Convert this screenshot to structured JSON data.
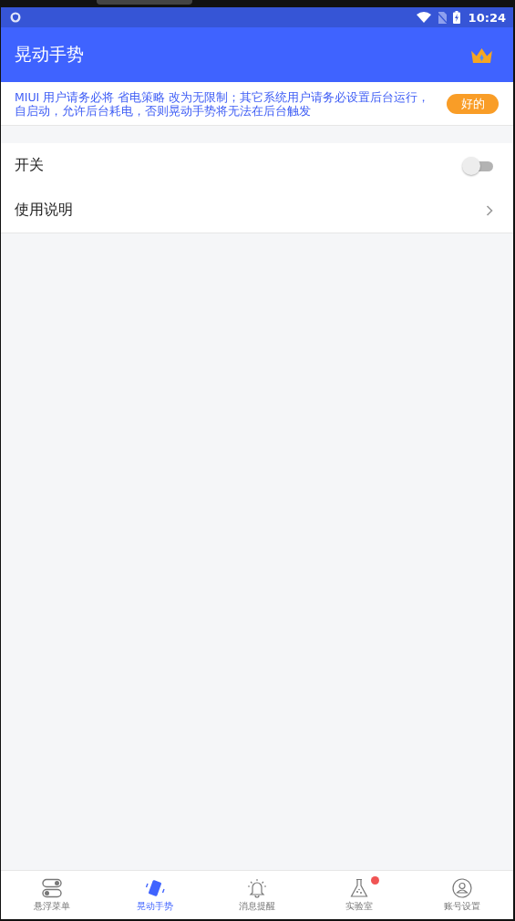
{
  "status_bar": {
    "time": "10:24"
  },
  "app_bar": {
    "title": "晃动手势"
  },
  "notice": {
    "text": "MIUI 用户请务必将 省电策略 改为无限制；其它系统用户请务必设置后台运行，自启动，允许后台耗电，否则晃动手势将无法在后台触发",
    "button": "好的"
  },
  "settings": [
    {
      "kind": "toggle",
      "label": "开关",
      "on": false
    },
    {
      "kind": "link",
      "label": "使用说明"
    }
  ],
  "tabs": [
    {
      "label": "悬浮菜单",
      "selected": false,
      "badge": false
    },
    {
      "label": "晃动手势",
      "selected": true,
      "badge": false
    },
    {
      "label": "消息提醒",
      "selected": false,
      "badge": false
    },
    {
      "label": "实验室",
      "selected": false,
      "badge": true
    },
    {
      "label": "账号设置",
      "selected": false,
      "badge": false
    }
  ]
}
